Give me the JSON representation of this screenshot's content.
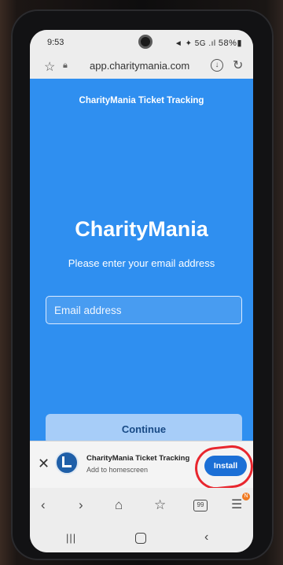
{
  "status_bar": {
    "time": "9:53",
    "icons": "◄ ✦ 5G .ıl",
    "battery": "58%▮"
  },
  "address_bar": {
    "url": "app.charitymania.com",
    "star_icon": "star-icon",
    "lock_icon": "lock-icon",
    "download_icon": "download-icon",
    "refresh_icon": "refresh-icon"
  },
  "page": {
    "header": "CharityMania Ticket Tracking",
    "brand": "CharityMania",
    "subtitle": "Please enter your email address",
    "email_placeholder": "Email address",
    "email_value": "",
    "continue_label": "Continue",
    "accent_color": "#2f8ff0"
  },
  "install_prompt": {
    "app_name": "CharityMania Ticket Tracking",
    "subtitle": "Add to homescreen",
    "install_label": "Install",
    "close_glyph": "✕",
    "highlight_color": "#e8262e"
  },
  "toolbar": {
    "back_glyph": "‹",
    "forward_glyph": "›",
    "home_glyph": "⌂",
    "bookmarks_glyph": "☆",
    "tabs_count": "99",
    "menu_glyph": "☰",
    "badge": "N"
  },
  "nav_bar": {
    "recents_glyph": "|||",
    "back_glyph": "‹"
  }
}
